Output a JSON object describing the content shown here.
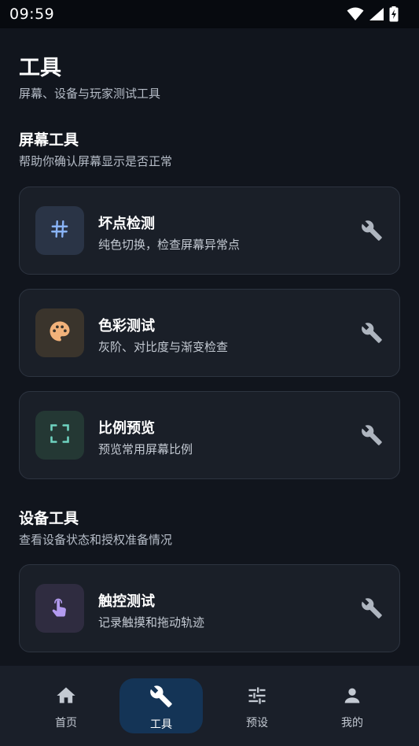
{
  "status_bar": {
    "time": "09:59"
  },
  "header": {
    "title": "工具",
    "subtitle": "屏幕、设备与玩家测试工具"
  },
  "sections": [
    {
      "title": "屏幕工具",
      "subtitle": "帮助你确认屏幕显示是否正常",
      "cards": [
        {
          "title": "坏点检测",
          "desc": "纯色切换，检查屏幕异常点",
          "icon": "hash-icon",
          "accent": "#8ab4f8",
          "icon_bg": "#2a3446"
        },
        {
          "title": "色彩测试",
          "desc": "灰阶、对比度与渐变检查",
          "icon": "palette-icon",
          "accent": "#f2b27a",
          "icon_bg": "#3a342c"
        },
        {
          "title": "比例预览",
          "desc": "预览常用屏幕比例",
          "icon": "fullscreen-icon",
          "accent": "#6fd3c0",
          "icon_bg": "#243834"
        }
      ]
    },
    {
      "title": "设备工具",
      "subtitle": "查看设备状态和授权准备情况",
      "cards": [
        {
          "title": "触控测试",
          "desc": "记录触摸和拖动轨迹",
          "icon": "touch-icon",
          "accent": "#b39bf0",
          "icon_bg": "#2f2c40"
        }
      ]
    }
  ],
  "bottom_nav": {
    "items": [
      {
        "label": "首页",
        "icon": "home-icon"
      },
      {
        "label": "工具",
        "icon": "wrench-icon",
        "active": true
      },
      {
        "label": "预设",
        "icon": "sliders-icon"
      },
      {
        "label": "我的",
        "icon": "person-icon"
      }
    ]
  },
  "colors": {
    "background": "#11151d",
    "card": "#1a1f28",
    "nav_active": "#143456",
    "wrench": "#aeb5bf"
  }
}
